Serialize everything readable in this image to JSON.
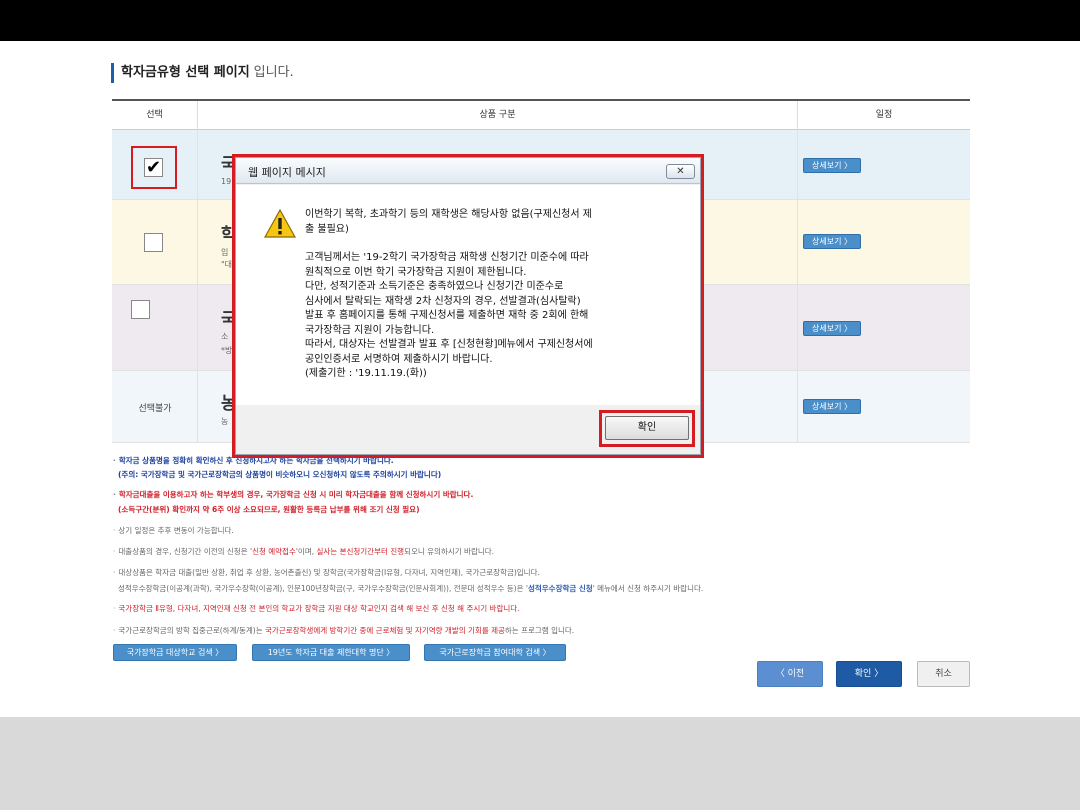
{
  "page": {
    "title_bold": "학자금유형 선택 페이지",
    "title_suffix": "입니다."
  },
  "table": {
    "headers": {
      "select": "선택",
      "product": "상품 구분",
      "schedule": "일정"
    },
    "rows": [
      {
        "title": "국가장학금",
        "sub1": "19",
        "sub2": "",
        "checked": true,
        "detail": "상세보기 〉"
      },
      {
        "title": "학",
        "sub1": "입",
        "sub2": "\"대",
        "checked": false,
        "detail": "상세보기 〉"
      },
      {
        "title": "국",
        "sub1": "소",
        "sub2": "*방",
        "checked": false,
        "detail": "상세보기 〉"
      },
      {
        "title": "농",
        "sub1": "농",
        "sub2": "",
        "select_label": "선택불가",
        "detail": "상세보기 〉"
      }
    ]
  },
  "notes": {
    "n1a": "학자금 상품명을 정확히 확인하신 후 신청하시고자 하는 학자금을 선택하시기 바랍니다.",
    "n1b": "(주의: 국가장학금 및 국가근로장학금의 상품명이 비슷하오니 오신청하지 않도록 주의하시기 바랍니다)",
    "n2a": "학자금대출을 이용하고자 하는 학부생의 경우, 국가장학금 신청 시 미리 학자금대출을 함께 신청하시기 바랍니다.",
    "n2b": "(소득구간(분위) 확인까지 약 6주 이상 소요되므로, 원활한 등록금 납부를 위해 조기 신청 필요)",
    "n3": "상기 일정은 추후 변동이 가능합니다.",
    "n4_pre": "대출상품의 경우, 신청기간 이전의 신청은 '",
    "n4_red1": "신청 예약접수",
    "n4_mid": "'이며, ",
    "n4_red2": "실사는 본신청기간부터 진행",
    "n4_post": "되오니 유의하시기 바랍니다.",
    "n5a": "대상상품은 학자금 대출(일반 상환, 취업 후 상환, 농어촌출신) 및 장학금(국가장학금(Ⅰ유형, 다자녀, 지역인재), 국가근로장학금)입니다.",
    "n5b_pre": "성적우수장학금(이공계(과학), 국가우수장학(이공계), 인문100년장학금(구, 국가우수장학금(인문사회계)), 전문대 성적우수 등)은 '",
    "n5b_blue": "성적우수장학금 신청",
    "n5b_post": "' 메뉴에서 신청 하주시기 바랍니다.",
    "n6": "국가장학금 Ⅱ유형, 다자녀, 지역인재 신청 전 본인의 학교가 장학금 지원 대상 학교인지 검색 해 보신 후 신청 해 주시기 바랍니다.",
    "n7_pre": "국가근로장학금의 방학 집중근로(하계/동계)는 ",
    "n7_red": "국가근로장학생에게 방학기간 중에 근로체험 및 자기역량 개발의 기회를 제공",
    "n7_post": "하는 프로그램 입니다."
  },
  "links": {
    "l1": "국가장학금 대상학교 검색 〉",
    "l2": "19년도 학자금 대출 제한대학 명단 〉",
    "l3": "국가근로장학금 참여대학 검색 〉"
  },
  "nav": {
    "prev": "〈  이전",
    "ok": "확인  〉",
    "cancel": "취소"
  },
  "dialog": {
    "title": "웹 페이지 메시지",
    "close": "✕",
    "lines_a": [
      "이번학기 복학, 초과학기 등의 재학생은 해당사항 없음(구제신청서 제",
      "출 불필요)"
    ],
    "lines_b": [
      "고객님께서는 '19-2학기 국가장학금 재학생 신청기간 미준수에 따라",
      "원칙적으로 이번 학기 국가장학금 지원이 제한됩니다.",
      "다만, 성적기준과 소득기준은 충족하였으나 신청기간 미준수로",
      "심사에서 탈락되는 재학생 2차 신청자의 경우, 선발결과(심사탈락)",
      "발표 후 홈페이지를 통해 구제신청서를 제출하면 재학 중 2회에 한해",
      "국가장학금 지원이 가능합니다.",
      "따라서, 대상자는 선발결과 발표 후 [신청현황]메뉴에서 구제신청서에",
      "공인인증서로 서명하여 제출하시기 바랍니다.",
      "(제출기한 : '19.11.19.(화))"
    ],
    "ok": "확인"
  },
  "colors": {
    "accent_blue": "#4a8fc9",
    "highlight_red": "#d51c23",
    "note_red": "#d0202a",
    "note_blue": "#1a3f9c"
  }
}
